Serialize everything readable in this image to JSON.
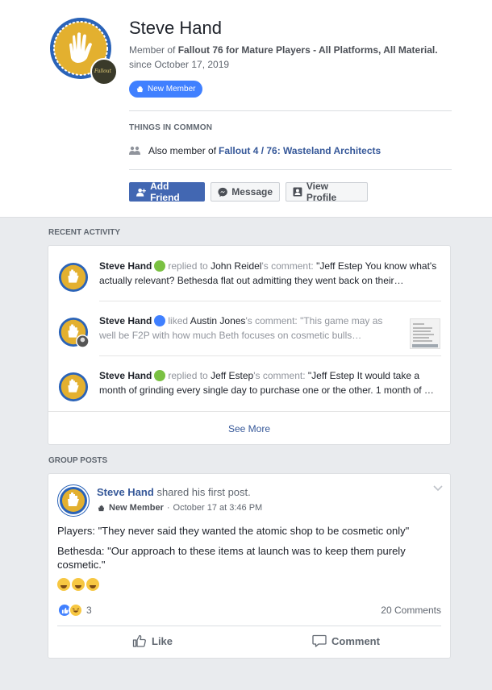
{
  "profile": {
    "name": "Steve Hand",
    "member_of_prefix": "Member of",
    "group_name": "Fallout 76 for Mature Players - All Platforms, All Material.",
    "since": "since October 17, 2019",
    "badge": "New Member",
    "mini_badge_text": "Fallout"
  },
  "things_in_common": {
    "heading": "THINGS IN COMMON",
    "also_prefix": "Also member of",
    "group_link": "Fallout 4 / 76: Wasteland Architects"
  },
  "actions": {
    "add_friend": "Add Friend",
    "message": "Message",
    "view_profile": "View Profile"
  },
  "recent_activity": {
    "heading": "RECENT ACTIVITY",
    "items": [
      {
        "who": "Steve Hand",
        "icon": "reply-icon",
        "verb": "replied to",
        "target": "John Reidel",
        "possessive": "'s comment:",
        "quote": "\"Jeff Estep You know what's actually relevant? Bethesda flat out admitting they went back on their…"
      },
      {
        "who": "Steve Hand",
        "icon": "like-icon",
        "verb": "liked",
        "target": "Austin Jones",
        "possessive": "'s comment:",
        "quote": "\"This game may as well be F2P with how much Beth focuses on cosmetic bulls…"
      },
      {
        "who": "Steve Hand",
        "icon": "reply-icon",
        "verb": "replied to",
        "target": "Jeff Estep",
        "possessive": "'s comment:",
        "quote": "\"Jeff Estep It would take a month of grinding every single day to purchase one or the other. 1 month of …"
      }
    ],
    "see_more": "See More"
  },
  "group_posts": {
    "heading": "GROUP POSTS",
    "post": {
      "author": "Steve Hand",
      "action": "shared his first post.",
      "badge": "New Member",
      "separator": "·",
      "timestamp": "October 17 at 3:46 PM",
      "line1": "Players: \"They never said they wanted the atomic shop to be cosmetic only\"",
      "line2": "Bethesda: \"Our approach to these items at launch was to keep them purely cosmetic.\"",
      "reaction_count": "3",
      "comments": "20 Comments",
      "like_label": "Like",
      "comment_label": "Comment"
    }
  },
  "colors": {
    "brand_blue": "#4267b2",
    "link_blue": "#365899",
    "badge_blue": "#4080ff",
    "reply_green": "#7ac142",
    "avatar_gold": "#e3b02f",
    "avatar_ring": "#2a63b8"
  }
}
